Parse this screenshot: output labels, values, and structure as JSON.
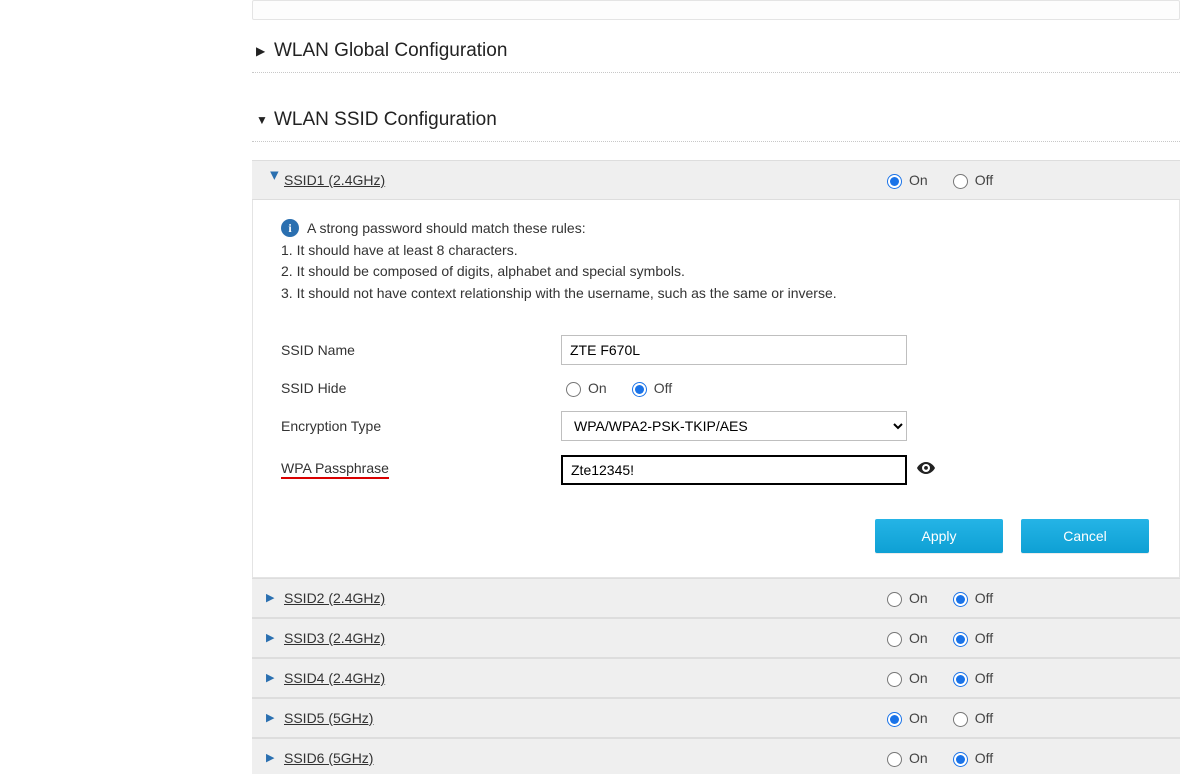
{
  "sections": {
    "global": {
      "title": "WLAN Global Configuration",
      "expanded": false
    },
    "ssid": {
      "title": "WLAN SSID Configuration",
      "expanded": true
    }
  },
  "radioLabels": {
    "on": "On",
    "off": "Off"
  },
  "ssid1": {
    "label": "SSID1 (2.4GHz)",
    "enabled": true,
    "info": {
      "lead": "A strong password should match these rules:",
      "rule1": "1. It should have at least 8 characters.",
      "rule2": "2. It should be composed of digits, alphabet and special symbols.",
      "rule3": "3. It should not have context relationship with the username, such as the same or inverse."
    },
    "fields": {
      "ssidName": {
        "label": "SSID Name",
        "value": "ZTE F670L"
      },
      "ssidHide": {
        "label": "SSID Hide",
        "value": "off"
      },
      "encryption": {
        "label": "Encryption Type",
        "value": "WPA/WPA2-PSK-TKIP/AES"
      },
      "passphrase": {
        "label": "WPA Passphrase",
        "value": "Zte12345!"
      }
    },
    "buttons": {
      "apply": "Apply",
      "cancel": "Cancel"
    }
  },
  "otherSSIDs": [
    {
      "label": "SSID2 (2.4GHz)",
      "enabled": false
    },
    {
      "label": "SSID3 (2.4GHz)",
      "enabled": false
    },
    {
      "label": "SSID4 (2.4GHz)",
      "enabled": false
    },
    {
      "label": "SSID5 (5GHz)",
      "enabled": true
    },
    {
      "label": "SSID6 (5GHz)",
      "enabled": false
    }
  ]
}
